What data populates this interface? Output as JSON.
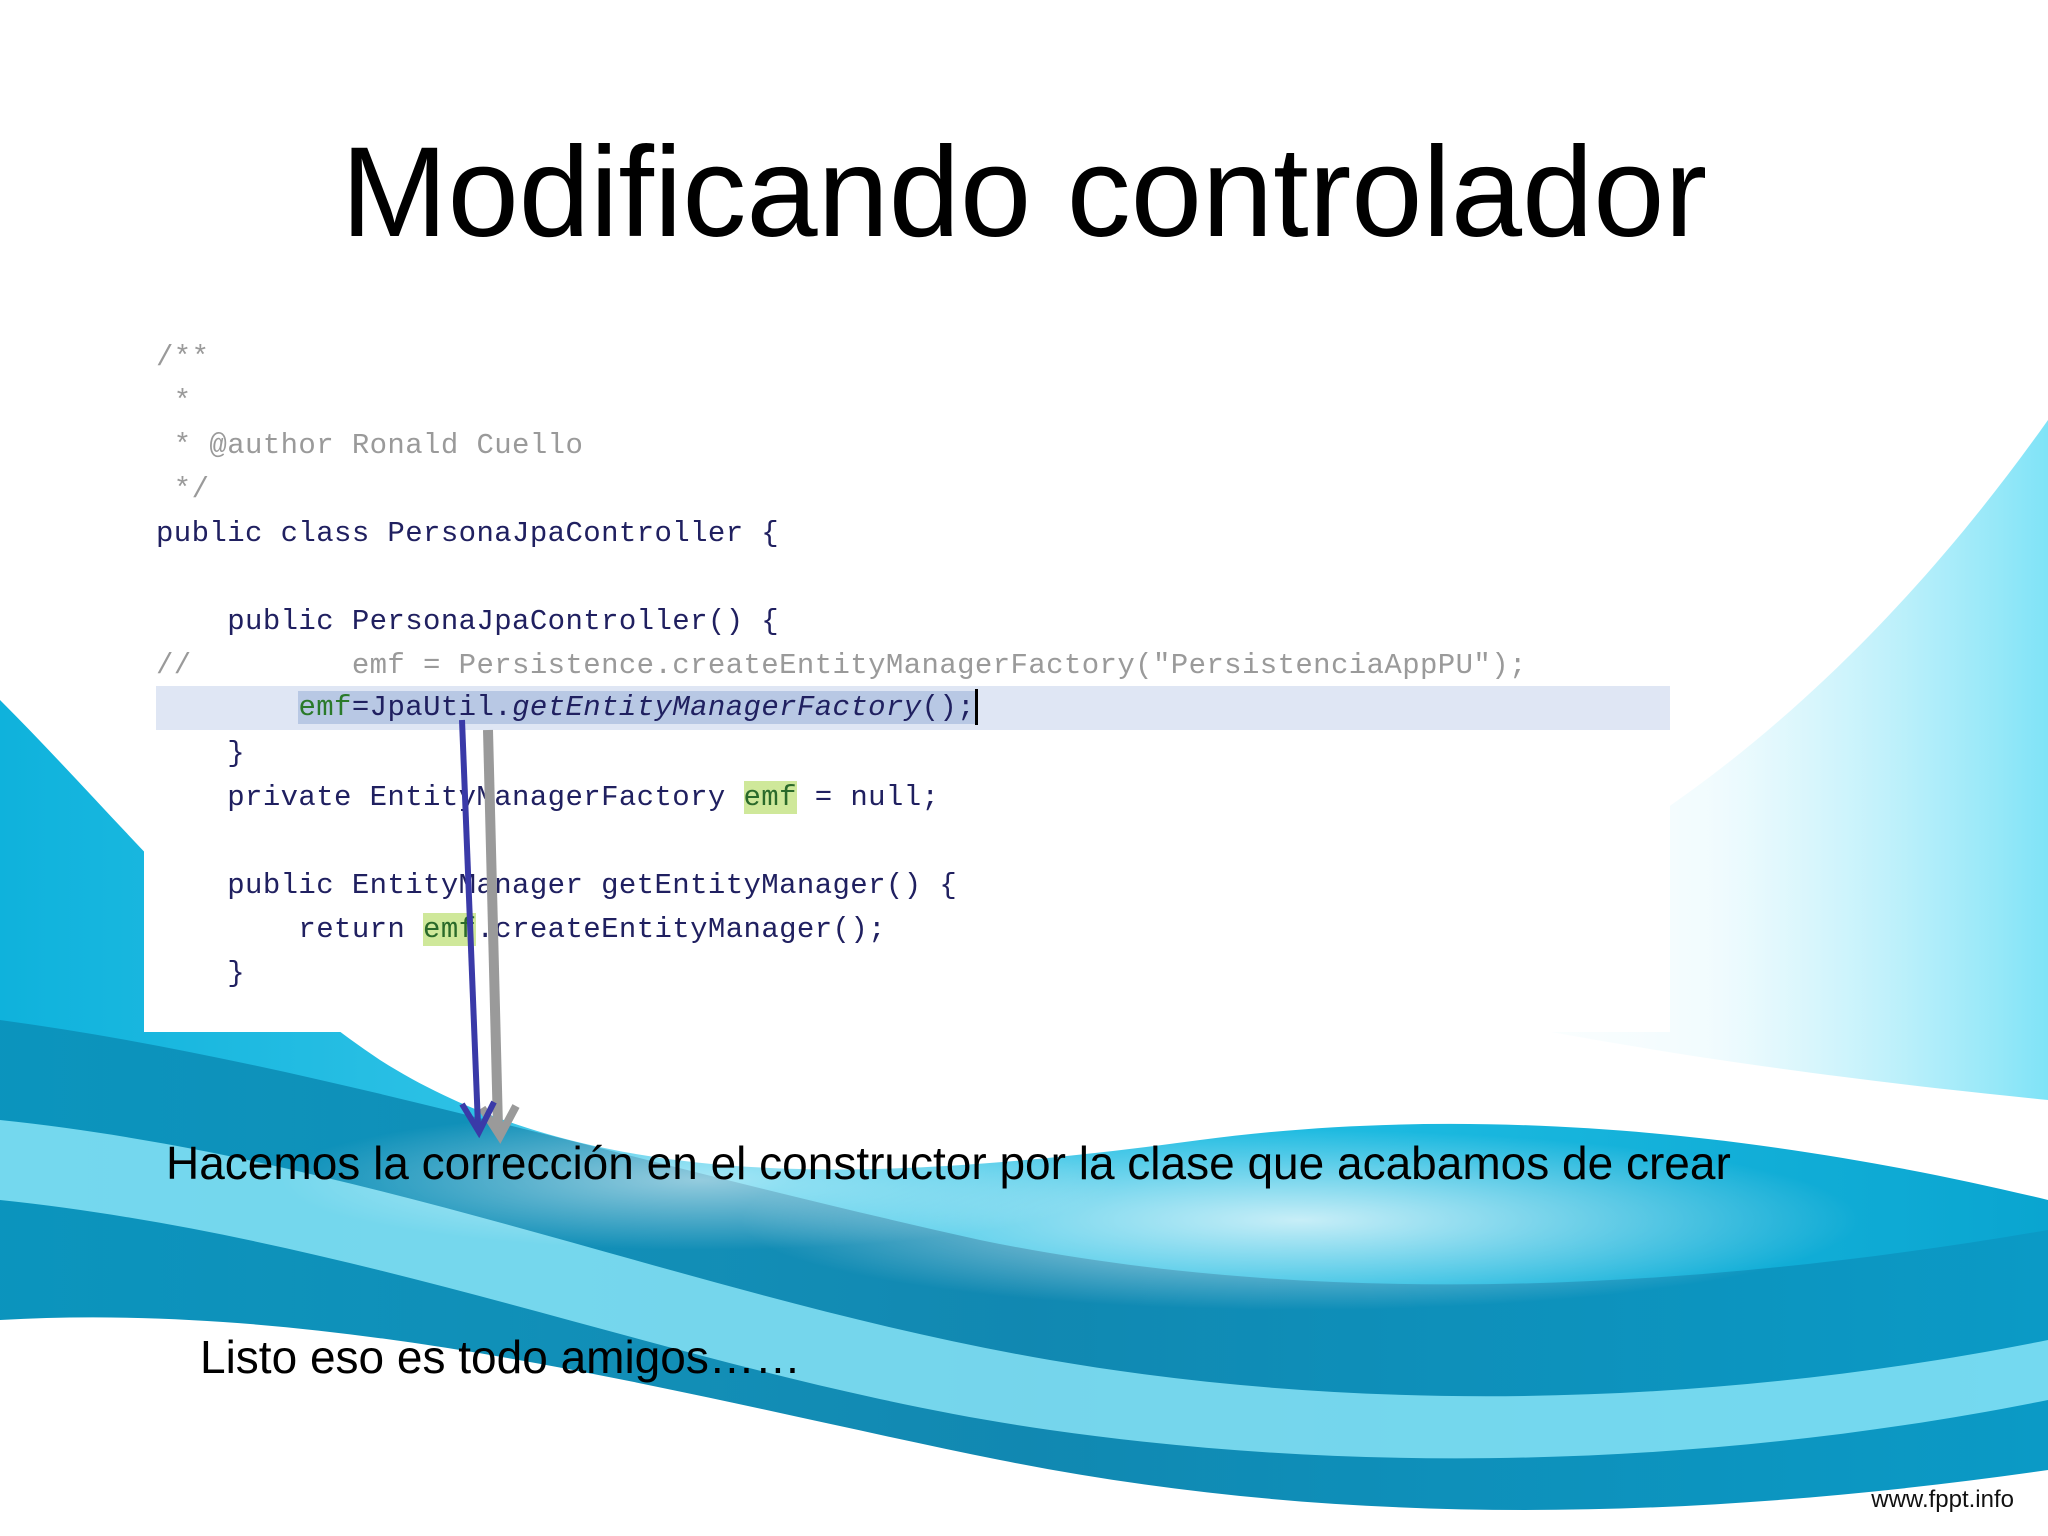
{
  "slide": {
    "title": "Modificando controlador",
    "caption": "Hacemos la corrección en el constructor por la clase que acabamos de crear",
    "closing": "Listo eso es todo amigos……",
    "footer": "www.fppt.info"
  },
  "code": {
    "l1": "/**",
    "l2": " *",
    "l3": " * @author Ronald Cuello",
    "l4": " */",
    "l5": "public class PersonaJpaController {",
    "l7": "    public PersonaJpaController() {",
    "l8": "//         emf = Persistence.createEntityManagerFactory(\"PersistenciaAppPU\");",
    "l9_indent": "        ",
    "l9_var": "emf",
    "l9_rest1": "=JpaUtil.",
    "l9_method": "getEntityManagerFactory",
    "l9_rest2": "();",
    "l10": "    }",
    "l11_a": "    private EntityManagerFactory ",
    "l11_var": "emf",
    "l11_b": " = null;",
    "l13": "    public EntityManager getEntityManager() {",
    "l14_a": "        return ",
    "l14_var": "emf",
    "l14_b": ".createEntityManager();",
    "l15": "    }"
  },
  "colors": {
    "accent": "#16b6dc",
    "accent_light": "#7fe3f7",
    "accent_dark": "#0a7fa8",
    "arrow_primary": "#3a3aa8",
    "arrow_secondary": "#9a9a9a"
  }
}
